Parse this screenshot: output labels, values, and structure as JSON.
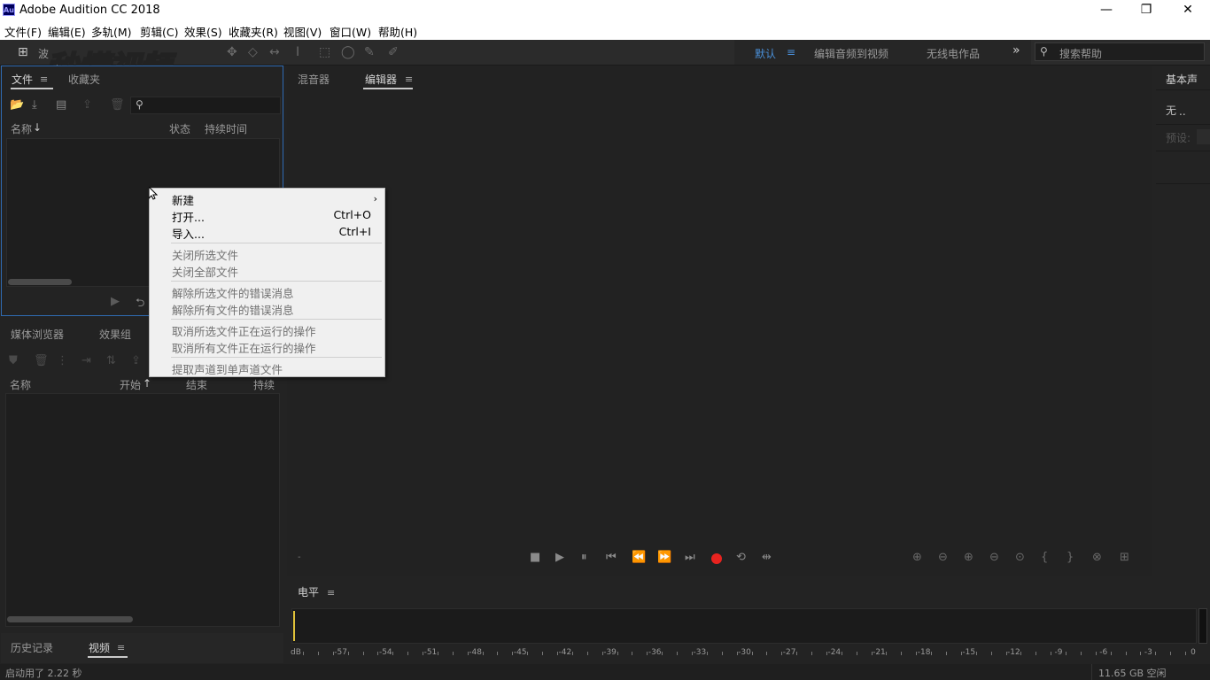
{
  "window": {
    "title": "Adobe Audition CC 2018",
    "icon": "Au",
    "minimize": "—",
    "restore": "❐",
    "close": "✕"
  },
  "menu": [
    "文件(F)",
    "编辑(E)",
    "多轨(M)",
    "剪辑(C)",
    "效果(S)",
    "收藏夹(R)",
    "视图(V)",
    "窗口(W)",
    "帮助(H)"
  ],
  "toolbar": {
    "waveform_label": "波",
    "workspaces": {
      "default": "默认",
      "edit_audio_to_video": "编辑音频到视频",
      "radio_production": "无线电作品",
      "more": "»"
    },
    "search_placeholder": "搜索帮助"
  },
  "watermark": "秒懂视频",
  "files_panel": {
    "tabs": [
      "文件",
      "收藏夹"
    ],
    "columns": {
      "name": "名称",
      "status": "状态",
      "duration": "持续时间"
    }
  },
  "media_panel": {
    "tabs": [
      "媒体浏览器",
      "效果组"
    ],
    "columns": {
      "name": "名称",
      "start": "开始",
      "end": "结束",
      "duration": "持续时"
    }
  },
  "history_panel": {
    "tabs": [
      "历史记录",
      "视频"
    ]
  },
  "editor": {
    "tabs": [
      "混音器",
      "编辑器"
    ],
    "time": "-"
  },
  "right_panel": {
    "title": "基本声",
    "item1": "无",
    "preset_label": "预设:"
  },
  "level_panel": {
    "title": "电平",
    "scale": [
      "dB",
      "-57",
      "-54",
      "-51",
      "-48",
      "-45",
      "-42",
      "-39",
      "-36",
      "-33",
      "-30",
      "-27",
      "-24",
      "-21",
      "-18",
      "-15",
      "-12",
      "-9",
      "-6",
      "-3",
      "0"
    ]
  },
  "context_menu": {
    "groups": [
      [
        {
          "label": "新建",
          "shortcut": "",
          "submenu": true,
          "enabled": true
        },
        {
          "label": "打开...",
          "shortcut": "Ctrl+O",
          "enabled": true
        },
        {
          "label": "导入...",
          "shortcut": "Ctrl+I",
          "enabled": true
        }
      ],
      [
        {
          "label": "关闭所选文件",
          "shortcut": "",
          "enabled": false
        },
        {
          "label": "关闭全部文件",
          "shortcut": "",
          "enabled": false
        }
      ],
      [
        {
          "label": "解除所选文件的错误消息",
          "shortcut": "",
          "enabled": false
        },
        {
          "label": "解除所有文件的错误消息",
          "shortcut": "",
          "enabled": false
        }
      ],
      [
        {
          "label": "取消所选文件正在运行的操作",
          "shortcut": "",
          "enabled": false
        },
        {
          "label": "取消所有文件正在运行的操作",
          "shortcut": "",
          "enabled": false
        }
      ],
      [
        {
          "label": "提取声道到单声道文件",
          "shortcut": "",
          "enabled": false
        }
      ]
    ]
  },
  "status": {
    "startup": "启动用了 2.22 秒",
    "free_space": "11.65 GB 空闲"
  },
  "colors": {
    "record": "#e8231f",
    "playhead": "#e0c23a",
    "accent_blue": "#4a90d9"
  }
}
